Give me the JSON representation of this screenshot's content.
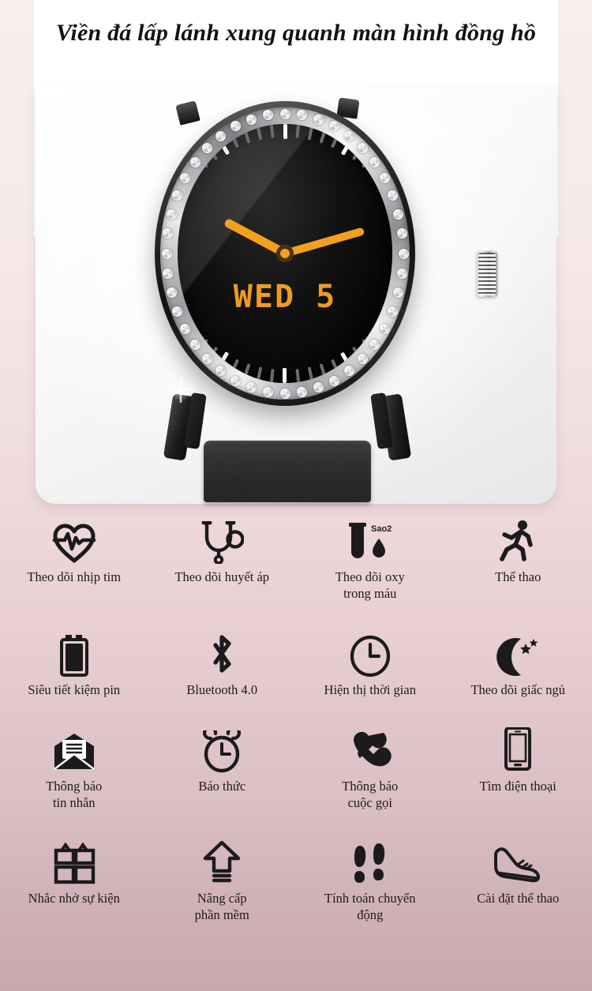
{
  "page": {
    "heading": "Viền đá lấp lánh xung quanh màn hình đồng hồ",
    "background_top_color": "#f9eeed",
    "background_bottom_color": "#c6a8ae",
    "accent_color": "#f2a01e"
  },
  "product": {
    "name": "rhinestone-bezel-smartwatch",
    "watch_face": {
      "date_text": "WED 5",
      "date_color": "#ef9a22",
      "hand_color": "#f2a01e",
      "dial_color": "#060606",
      "hour_hand_angle": -62,
      "minute_hand_angle": 74,
      "tick_count": 60,
      "stone_count": 44
    }
  },
  "features": {
    "rows": [
      {
        "items": [
          {
            "icon": "heart-pulse-icon",
            "label": "Theo dõi nhịp tim"
          },
          {
            "icon": "stethoscope-icon",
            "label": "Theo dõi huyết áp"
          },
          {
            "icon": "blood-oxygen-icon",
            "label": "Theo dõi oxy\ntrong máu",
            "icon_badge": "Sao2"
          },
          {
            "icon": "running-person-icon",
            "label": "Thể thao"
          }
        ]
      },
      {
        "items": [
          {
            "icon": "battery-icon",
            "label": "Siêu tiết kiệm pin"
          },
          {
            "icon": "bluetooth-icon",
            "label": "Bluetooth 4.0"
          },
          {
            "icon": "clock-icon",
            "label": "Hiện thị thời gian"
          },
          {
            "icon": "moon-stars-icon",
            "label": "Theo dõi giấc ngủ"
          }
        ]
      },
      {
        "items": [
          {
            "icon": "message-envelope-icon",
            "label": "Thông báo\ntin nhắn"
          },
          {
            "icon": "alarm-clock-icon",
            "label": "Báo thức"
          },
          {
            "icon": "phone-handset-icon",
            "label": "Thông báo\ncuộc gọi"
          },
          {
            "icon": "smartphone-icon",
            "label": "Tìm điện thoại"
          }
        ]
      },
      {
        "items": [
          {
            "icon": "gift-boxes-icon",
            "label": "Nhắc nhở sự kiện"
          },
          {
            "icon": "upload-arrow-icon",
            "label": "Nâng cấp\nphần mềm"
          },
          {
            "icon": "footprints-icon",
            "label": "Tính toán chuyển\nđộng"
          },
          {
            "icon": "sneaker-icon",
            "label": "Cài đặt thể thao"
          }
        ]
      }
    ]
  }
}
